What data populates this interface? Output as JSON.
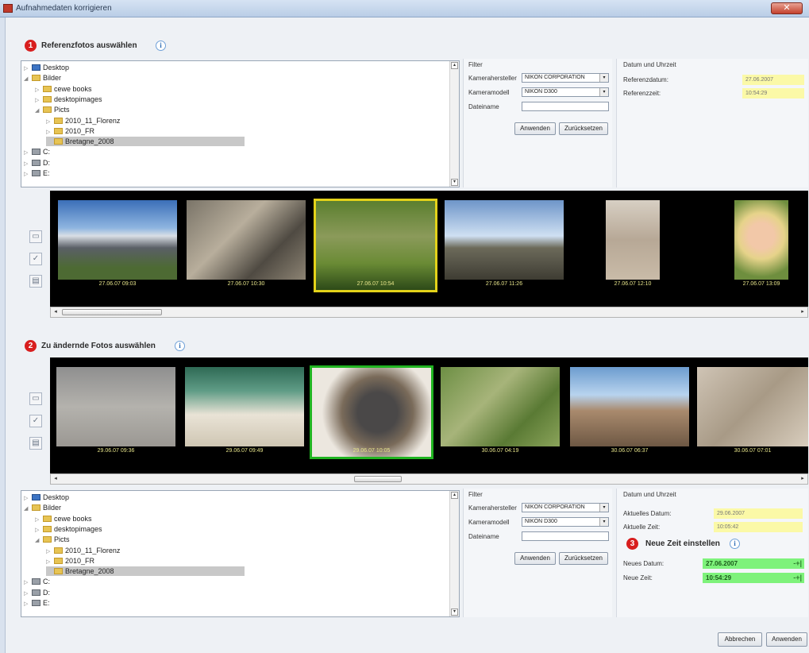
{
  "window": {
    "title": "Aufnahmedaten korrigieren",
    "close": "✕"
  },
  "step1": {
    "number": "1",
    "title": "Referenzfotos auswählen"
  },
  "step2": {
    "number": "2",
    "title": "Zu ändernde Fotos auswählen"
  },
  "step3": {
    "number": "3",
    "title": "Neue Zeit einstellen"
  },
  "info_glyph": "i",
  "tree": {
    "items": [
      {
        "label": "Desktop",
        "icon": "desktop-icon",
        "level": 0,
        "expander": "▷"
      },
      {
        "label": "Bilder",
        "icon": "folder-icon",
        "level": 0,
        "expander": "◢"
      },
      {
        "label": "cewe books",
        "icon": "folder-icon",
        "level": 1,
        "expander": "▷"
      },
      {
        "label": "desktopimages",
        "icon": "folder-icon",
        "level": 1,
        "expander": "▷"
      },
      {
        "label": "Picts",
        "icon": "folder-icon",
        "level": 1,
        "expander": "◢"
      },
      {
        "label": "2010_11_Florenz",
        "icon": "folder-icon",
        "level": 2,
        "expander": "▷"
      },
      {
        "label": "2010_FR",
        "icon": "folder-icon",
        "level": 2,
        "expander": "▷"
      },
      {
        "label": "Bretagne_2008",
        "icon": "folder-icon",
        "level": 2,
        "expander": "",
        "selected": true
      },
      {
        "label": "C:",
        "icon": "drive-icon",
        "level": 0,
        "expander": "▷"
      },
      {
        "label": "D:",
        "icon": "drive-icon",
        "level": 0,
        "expander": "▷"
      },
      {
        "label": "E:",
        "icon": "drive-icon",
        "level": 0,
        "expander": "▷"
      }
    ]
  },
  "filter": {
    "title": "Filter",
    "maker_label": "Kamerahersteller",
    "maker_value": "NIKON CORPORATION",
    "model_label": "Kameramodell",
    "model_value": "NIKON D300",
    "filename_label": "Dateiname",
    "apply": "Anwenden",
    "reset": "Zurücksetzen"
  },
  "ref_datetime": {
    "title": "Datum und Uhrzeit",
    "date_label": "Referenzdatum:",
    "date_value": "27.06.2007",
    "time_label": "Referenzzeit:",
    "time_value": "10:54:29"
  },
  "cur_datetime": {
    "title": "Datum und Uhrzeit",
    "date_label": "Aktuelles Datum:",
    "date_value": "29.06.2007",
    "time_label": "Aktuelle Zeit:",
    "time_value": "10:05:42"
  },
  "new_time": {
    "date_label": "Neues Datum:",
    "date_value": "27.06.2007",
    "time_label": "Neue Zeit:",
    "time_value": "10:54:29",
    "spin": "-+|"
  },
  "ref_photos": [
    {
      "caption": "27.06.07 09:03",
      "name": "house-photo"
    },
    {
      "caption": "27.06.07 10:30",
      "name": "rocks-photo"
    },
    {
      "caption": "27.06.07 10:54",
      "name": "garden-cottage-photo",
      "selected": true
    },
    {
      "caption": "27.06.07 11:26",
      "name": "coast-photo"
    },
    {
      "caption": "27.06.07 12:10",
      "name": "girl-beach-photo"
    },
    {
      "caption": "27.06.07 13:09",
      "name": "girl-portrait-photo"
    }
  ],
  "change_photos": [
    {
      "caption": "29.06.07 09:36",
      "name": "feet-photo"
    },
    {
      "caption": "29.06.07 09:49",
      "name": "kids-beach-photo"
    },
    {
      "caption": "29.06.07 10:05",
      "name": "seaweed-closeup-photo",
      "selected": true
    },
    {
      "caption": "30.06.07 04:19",
      "name": "grass-photo"
    },
    {
      "caption": "30.06.07 06:37",
      "name": "rock-kids-photo"
    },
    {
      "caption": "30.06.07 07:01",
      "name": "seaweed-sand-photo"
    }
  ],
  "scroll": {
    "left": "◂",
    "right": "▸",
    "up": "▴",
    "down": "▾"
  },
  "tools": {
    "folder": "▭",
    "check": "✓",
    "doc": "▤"
  },
  "footer": {
    "cancel": "Abbrechen",
    "apply": "Anwenden"
  }
}
